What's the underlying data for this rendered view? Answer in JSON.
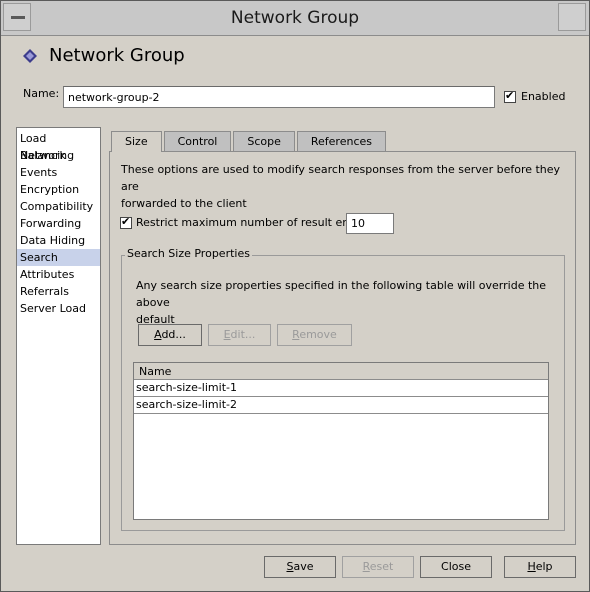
{
  "window": {
    "title": "Network Group"
  },
  "page": {
    "title": "Network Group"
  },
  "name": {
    "label": "Name:",
    "value": "network-group-2"
  },
  "enabled": {
    "label": "Enabled",
    "checked": true
  },
  "sidebar": {
    "items": [
      {
        "label": "Load Balancing"
      },
      {
        "label": "Network"
      },
      {
        "label": "Events"
      },
      {
        "label": "Encryption"
      },
      {
        "label": "Compatibility"
      },
      {
        "label": "Forwarding"
      },
      {
        "label": "Data Hiding"
      },
      {
        "label": "Search",
        "selected": true
      },
      {
        "label": "Attributes"
      },
      {
        "label": "Referrals"
      },
      {
        "label": "Server Load"
      }
    ]
  },
  "tabs": [
    {
      "label": "Size",
      "active": true
    },
    {
      "label": "Control"
    },
    {
      "label": "Scope"
    },
    {
      "label": "References"
    }
  ],
  "size_tab": {
    "description_line1": "These options are used to modify search responses from the server before they are",
    "description_line2": "forwarded to the client",
    "restrict_label": "Restrict maximum number of result entries",
    "restrict_checked": true,
    "limit_value": "10",
    "group_title": "Search Size Properties",
    "group_desc_line1": "Any search size properties specified in the following table will override the above",
    "group_desc_line2": "default",
    "add_label_u": "A",
    "add_label_rest": "dd...",
    "edit_label_u": "E",
    "edit_label_rest": "dit...",
    "remove_label_u": "R",
    "remove_label_rest": "emove",
    "table": {
      "header": "Name",
      "rows": [
        "search-size-limit-1",
        "search-size-limit-2"
      ]
    }
  },
  "footer": {
    "save_u": "S",
    "save_rest": "ave",
    "reset_u": "R",
    "reset_rest": "eset",
    "close": "Close",
    "help_u": "H",
    "help_rest": "elp"
  },
  "colors": {
    "background": "#d4d0c8",
    "selection": "#c8d2ea",
    "icon": "#3c3c8c"
  },
  "icons": {
    "page": "diamond-icon",
    "checkbox": "check-icon"
  }
}
